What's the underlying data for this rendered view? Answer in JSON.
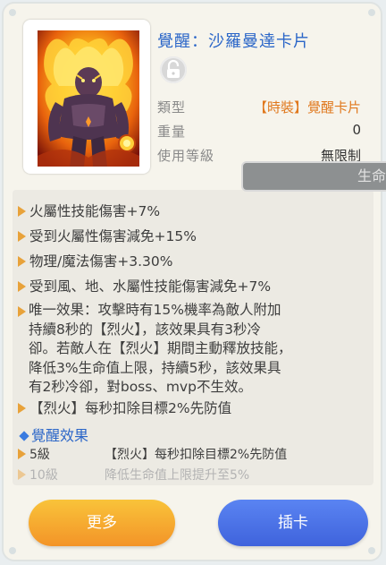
{
  "item": {
    "title": "覺醒：沙羅曼達卡片",
    "lock_icon": "lock-icon",
    "rows": {
      "type_label": "類型",
      "type_value": "【時裝】覺醒卡片",
      "weight_label": "重量",
      "weight_value": "0",
      "level_label": "使用等級",
      "level_value": "無限制"
    }
  },
  "tooltip": {
    "text": "生命"
  },
  "effects": {
    "lines": [
      "火屬性技能傷害+7%",
      "受到火屬性傷害減免+15%",
      "物理/魔法傷害+3.30%",
      "受到風、地、水屬性技能傷害減免+7%"
    ],
    "unique_1": "唯一效果：攻擊時有15%機率為敵人附加",
    "unique_2": "持續8秒的【烈火】，該效果具有3秒冷",
    "unique_3": "卻。若敵人在【烈火】期間主動釋放技能，",
    "unique_4": "降低3%生命值上限，持續5秒，該效果具",
    "unique_5": "有2秒冷卻，對boss、mvp不生效。",
    "burn": "【烈火】每秒扣除目標2%先防值"
  },
  "awakening": {
    "heading": "覺醒效果",
    "levels": [
      {
        "level": "5級",
        "desc": "【烈火】每秒扣除目標2%先防值",
        "active": true
      },
      {
        "level": "10級",
        "desc": "降低生命值上限提升至5%",
        "active": false
      }
    ]
  },
  "buttons": {
    "more": "更多",
    "insert": "插卡"
  },
  "colors": {
    "title_blue": "#2b66c8",
    "type_orange": "#e0781d",
    "arrow_orange": "#e8a23a",
    "more_button": "#f5a830",
    "insert_button": "#4a70e6"
  }
}
